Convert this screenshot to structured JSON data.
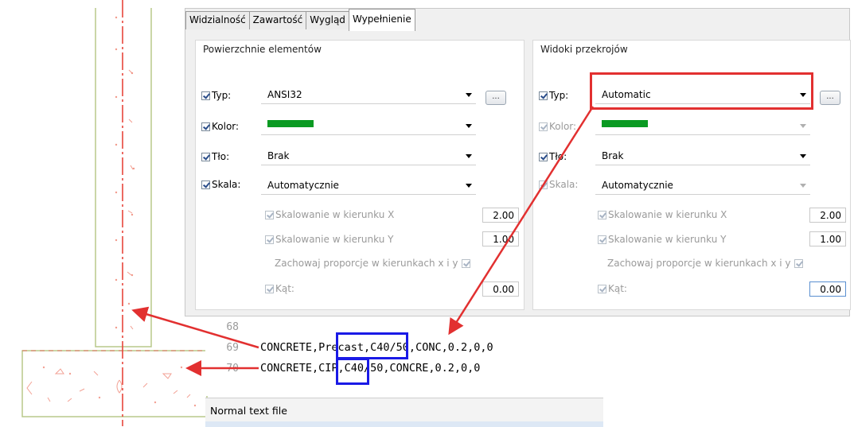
{
  "tabs": [
    {
      "label": "Widzialność",
      "active": false
    },
    {
      "label": "Zawartość",
      "active": false
    },
    {
      "label": "Wygląd",
      "active": false
    },
    {
      "label": "Wypełnienie",
      "active": true
    }
  ],
  "left_panel": {
    "title": "Powierzchnie elementów",
    "typ": {
      "label": "Typ:",
      "value": "ANSI32",
      "button": "..."
    },
    "kolor": {
      "label": "Kolor:",
      "swatch_color": "#0a9a22"
    },
    "tlo": {
      "label": "Tło:",
      "value": "Brak"
    },
    "skala": {
      "label": "Skala:",
      "value": "Automatycznie"
    },
    "scale_x": {
      "label": "Skalowanie w kierunku X",
      "value": "2.00"
    },
    "scale_y": {
      "label": "Skalowanie w kierunku Y",
      "value": "1.00"
    },
    "keep_ratio": {
      "label": "Zachowaj proporcje w kierunkach x i y"
    },
    "kat": {
      "label": "Kąt:",
      "value": "0.00"
    }
  },
  "right_panel": {
    "title": "Widoki przekrojów",
    "typ": {
      "label": "Typ:",
      "value": "Automatic",
      "button": "..."
    },
    "kolor": {
      "label": "Kolor:",
      "swatch_color": "#0a9a22"
    },
    "tlo": {
      "label": "Tło:",
      "value": "Brak"
    },
    "skala": {
      "label": "Skala:",
      "value": "Automatycznie"
    },
    "scale_x": {
      "label": "Skalowanie w kierunku X",
      "value": "2.00"
    },
    "scale_y": {
      "label": "Skalowanie w kierunku Y",
      "value": "1.00"
    },
    "keep_ratio": {
      "label": "Zachowaj proporcje w kierunkach x i y"
    },
    "kat": {
      "label": "Kąt:",
      "value": "0.00"
    }
  },
  "editor": {
    "lines": [
      {
        "number": "68",
        "text": ""
      },
      {
        "number": "69",
        "text": "CONCRETE,Precast,C40/50,CONC,0.2,0,0"
      },
      {
        "number": "70",
        "text": "CONCRETE,CIP,C40/50,CONCRE,0.2,0,0"
      }
    ],
    "status": "Normal text file"
  },
  "colors": {
    "annotation_red": "#e23030",
    "annotation_blue": "#1a1ae6",
    "drawing_red": "#e8453c",
    "drawing_outline": "#b8c98a"
  }
}
